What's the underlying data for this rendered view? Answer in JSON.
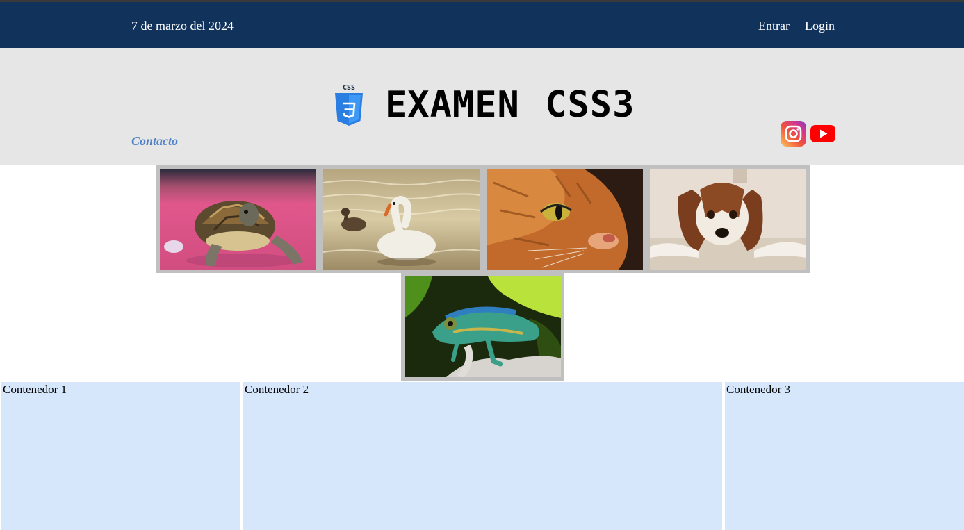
{
  "topbar": {
    "date": "7 de marzo del 2024",
    "nav": [
      "Entrar",
      "Login"
    ]
  },
  "header": {
    "logo_badge": "CSS",
    "title": "EXAMEN  CSS3",
    "contact_link": "Contacto",
    "social_icons": [
      "instagram-icon",
      "youtube-icon"
    ]
  },
  "gallery": [
    "turtle",
    "swan",
    "cat",
    "dog",
    "chameleon"
  ],
  "containers": [
    "Contenedor 1",
    "Contenedor 2",
    "Contenedor 3"
  ],
  "colors": {
    "topbar": "#10325b",
    "header": "#e6e6e6",
    "contact": "#4f82c8",
    "container": "#d6e7fb"
  }
}
